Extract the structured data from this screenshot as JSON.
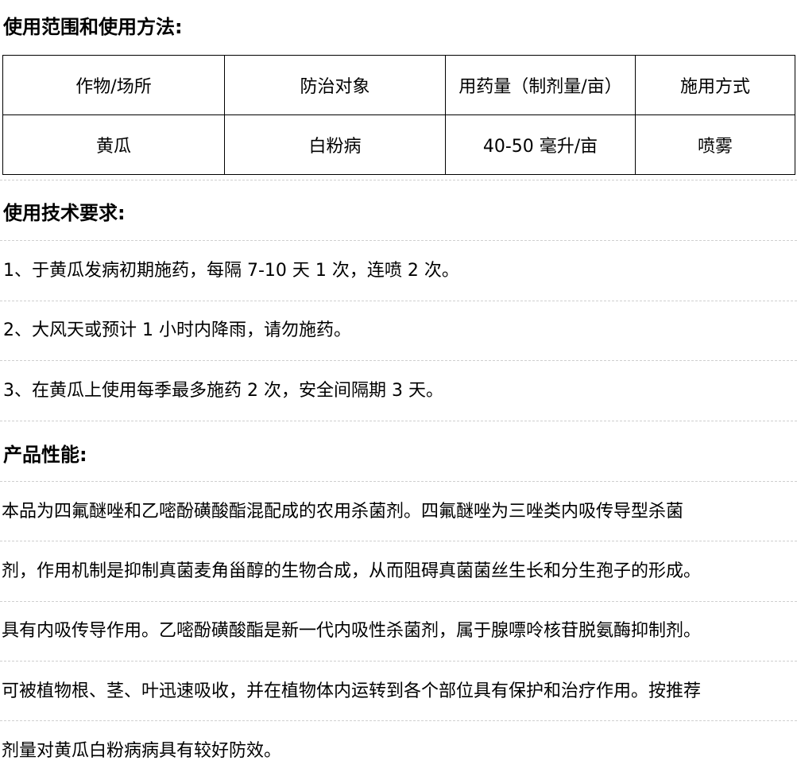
{
  "section_usage": {
    "heading": "使用范围和使用方法:",
    "table": {
      "headers": [
        "作物/场所",
        "防治对象",
        "用药量（制剂量/亩）",
        "施用方式"
      ],
      "row": [
        "黄瓜",
        "白粉病",
        "40-50 毫升/亩",
        "喷雾"
      ]
    }
  },
  "section_tech": {
    "heading": "使用技术要求:",
    "items": [
      "1、于黄瓜发病初期施药，每隔 7-10 天 1 次，连喷 2 次。",
      "2、大风天或预计 1 小时内降雨，请勿施药。",
      "3、在黄瓜上使用每季最多施药 2 次，安全间隔期 3 天。"
    ]
  },
  "section_perf": {
    "heading": "产品性能:",
    "lines": [
      "本品为四氟醚唑和乙嘧酚磺酸酯混配成的农用杀菌剂。四氟醚唑为三唑类内吸传导型杀菌",
      "剂，作用机制是抑制真菌麦角甾醇的生物合成，从而阻碍真菌菌丝生长和分生孢子的形成。",
      "具有内吸传导作用。乙嘧酚磺酸酯是新一代内吸性杀菌剂，属于腺嘌呤核苷脱氨酶抑制剂。",
      "可被植物根、茎、叶迅速吸收，并在植物体内运转到各个部位具有保护和治疗作用。按推荐",
      "剂量对黄瓜白粉病病具有较好防效。"
    ]
  }
}
